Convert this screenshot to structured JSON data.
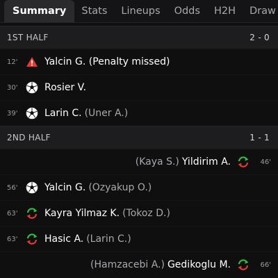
{
  "tabs": [
    {
      "label": "Summary",
      "active": true
    },
    {
      "label": "Stats"
    },
    {
      "label": "Lineups"
    },
    {
      "label": "Odds"
    },
    {
      "label": "H2H"
    },
    {
      "label": "Draw"
    }
  ],
  "first_half": {
    "title": "1ST HALF",
    "score": "2 - 0",
    "events": [
      {
        "minute": "12'",
        "icon": "penalty-missed-icon",
        "player": "Yalcin G. (Penalty missed)",
        "assist": ""
      },
      {
        "minute": "30'",
        "icon": "goal-ball-icon",
        "player": "Rosier V.",
        "assist": ""
      },
      {
        "minute": "39'",
        "icon": "goal-ball-icon",
        "player": "Larin C.",
        "assist": "(Uner A.)"
      }
    ]
  },
  "second_half": {
    "title": "2ND HALF",
    "score": "1 - 1",
    "events": [
      {
        "side": "away",
        "minute": "46'",
        "icon": "substitution-icon",
        "player": "Yildirim A.",
        "assist": "(Kaya S.)"
      },
      {
        "side": "home",
        "minute": "56'",
        "icon": "goal-ball-icon",
        "player": "Yalcin G.",
        "assist": "(Ozyakup O.)"
      },
      {
        "side": "home",
        "minute": "63'",
        "icon": "substitution-icon",
        "player": "Kayra Yilmaz K.",
        "assist": "(Tokoz D.)"
      },
      {
        "side": "home",
        "minute": "63'",
        "icon": "substitution-icon",
        "player": "Hasic A.",
        "assist": "(Larin C.)"
      },
      {
        "side": "away",
        "minute": "66'",
        "icon": "substitution-icon",
        "player": "Gedikoglu M.",
        "assist": "(Hamzacebi A.)"
      }
    ]
  },
  "colors": {
    "warning": "#e53935",
    "sub_green": "#2fbf3f",
    "sub_red": "#e53935"
  }
}
